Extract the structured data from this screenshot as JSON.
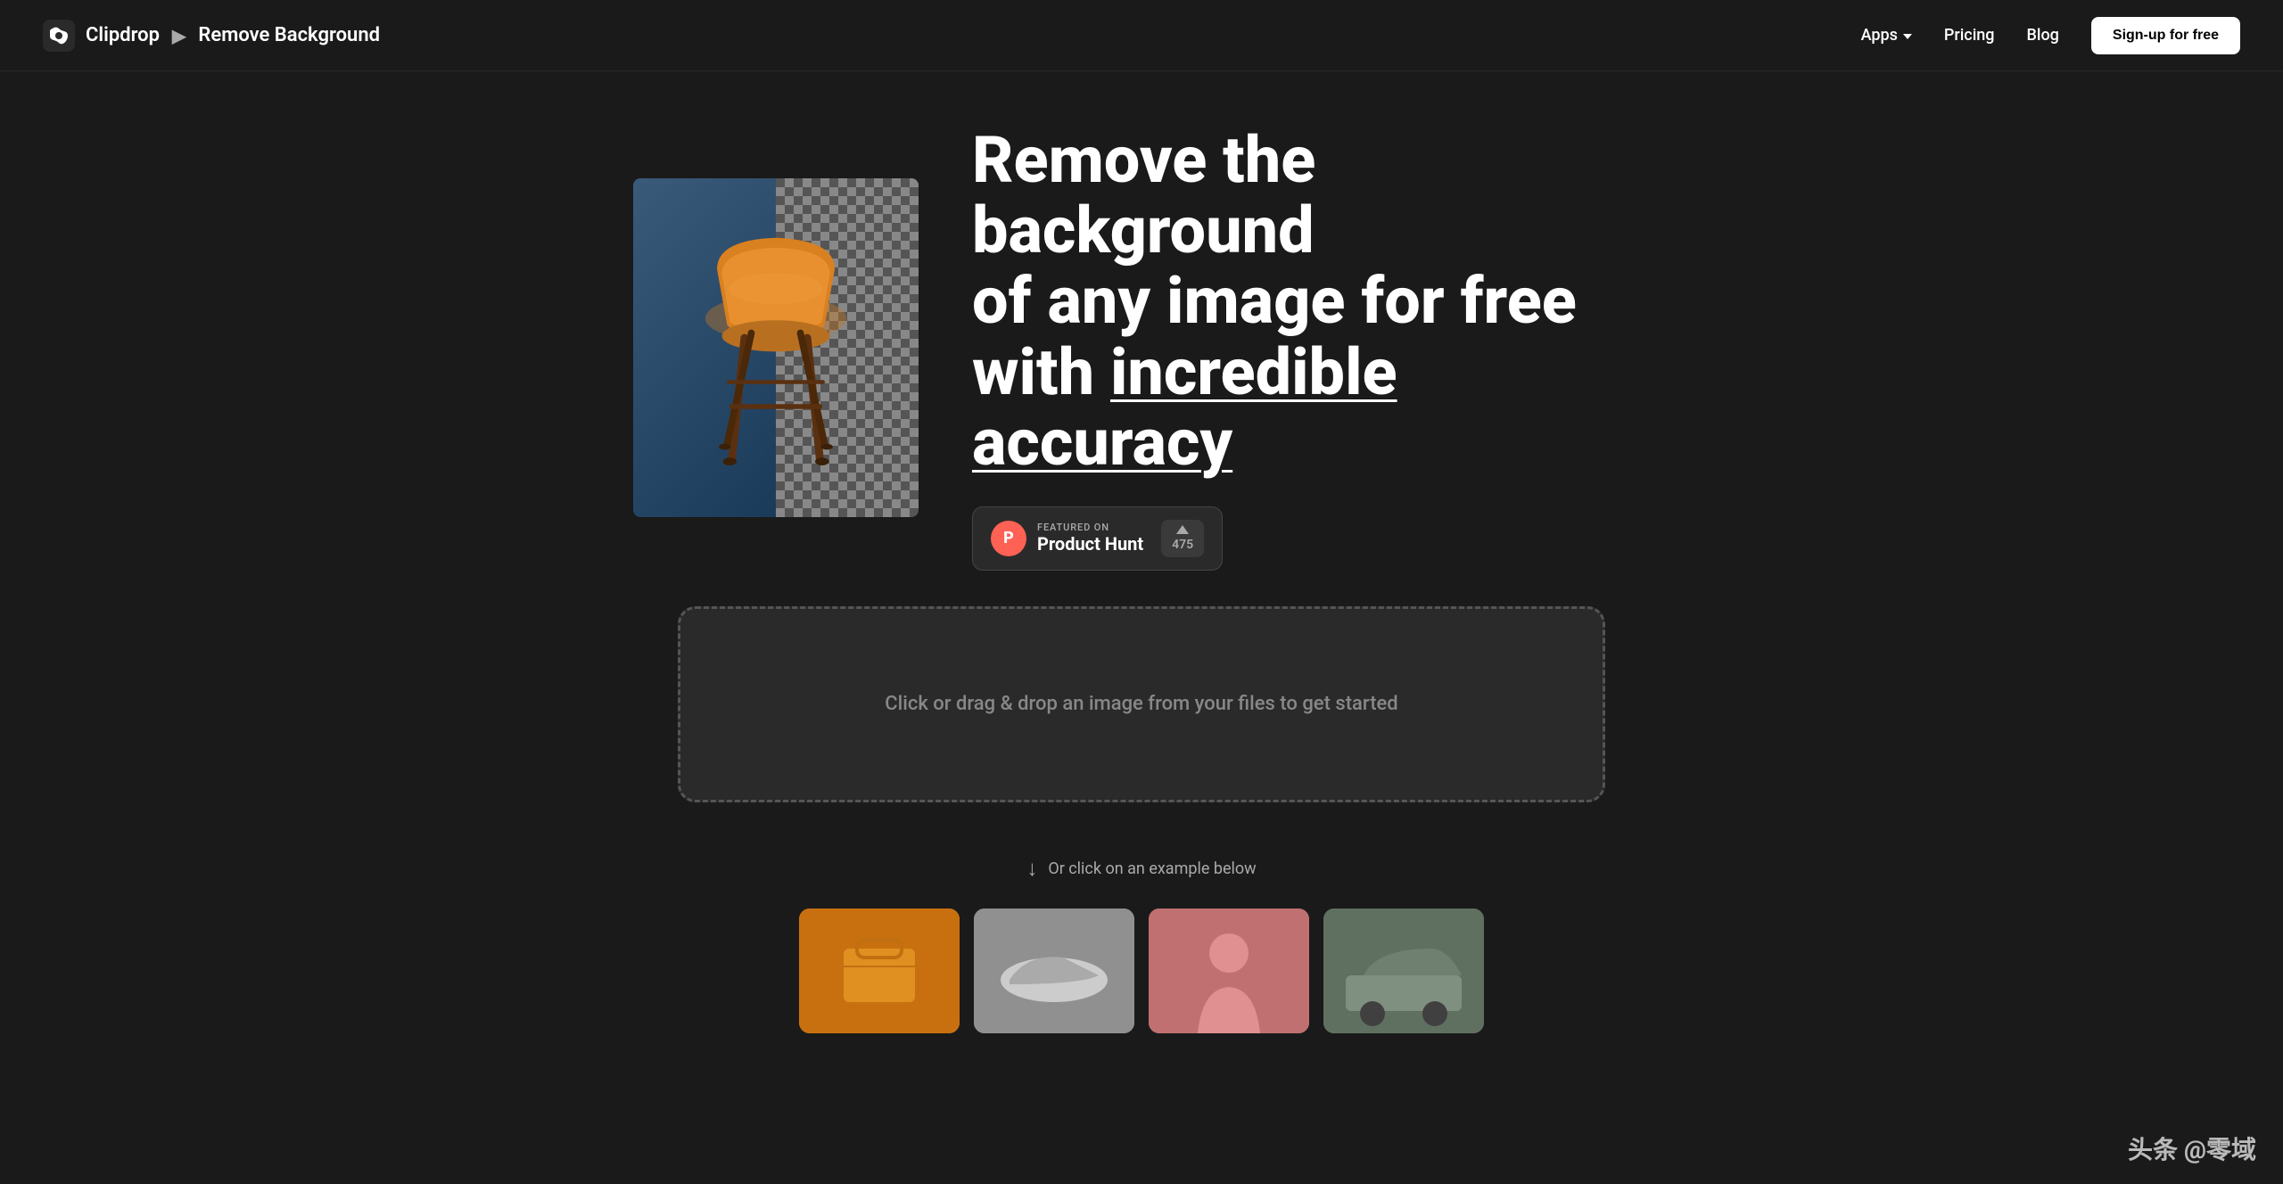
{
  "navbar": {
    "brand": "Clipdrop",
    "arrow": "▶",
    "page_title": "Remove Background",
    "nav_apps": "Apps",
    "nav_pricing": "Pricing",
    "nav_blog": "Blog",
    "signup_label": "Sign-up for free"
  },
  "hero": {
    "heading_line1": "Remove the background",
    "heading_line2": "of any image for free",
    "heading_line3_prefix": "with ",
    "heading_line3_highlight": "incredible accuracy"
  },
  "product_hunt": {
    "logo_letter": "P",
    "featured_on": "FEATURED ON",
    "name": "Product Hunt",
    "vote_count": "475"
  },
  "dropzone": {
    "placeholder": "Click or drag & drop an image from your files to get started"
  },
  "or_click": {
    "text": "Or click on an example below"
  },
  "watermark": {
    "text": "头条 @零域"
  }
}
